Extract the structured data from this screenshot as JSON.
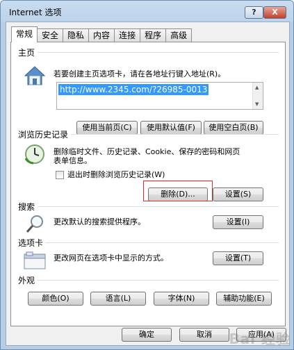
{
  "window": {
    "title": "Internet 选项",
    "help_label": "?",
    "close_label": "X"
  },
  "tabs": [
    {
      "label": "常规"
    },
    {
      "label": "安全"
    },
    {
      "label": "隐私"
    },
    {
      "label": "内容"
    },
    {
      "label": "连接"
    },
    {
      "label": "程序"
    },
    {
      "label": "高级"
    }
  ],
  "homepage": {
    "label": "主页",
    "description": "若要创建主页选项卡，请在各地址行键入地址(R)。",
    "url": "http://www.2345.com/?26985-0013",
    "use_current": "使用当前页(C)",
    "use_default": "使用默认值(F)",
    "use_blank": "使用空白页(B)"
  },
  "history": {
    "label": "浏览历史记录",
    "description_line1": "删除临时文件、历史记录、Cookie、保存的密码和网页",
    "description_line2": "表单信息。",
    "checkbox_label": "退出时删除浏览历史记录(W)",
    "delete_button": "删除(D)...",
    "settings_button": "设置(S)"
  },
  "search": {
    "label": "搜索",
    "description": "更改默认的搜索提供程序。",
    "settings_button": "设置(I)"
  },
  "tabs_section": {
    "label": "选项卡",
    "description": "更改网页在选项卡中显示的方式。",
    "settings_button": "设置(T)"
  },
  "appearance": {
    "label": "外观",
    "colors": "颜色(O)",
    "languages": "语言(L)",
    "fonts": "字体(N)",
    "accessibility": "辅助功能(E)"
  },
  "footer": {
    "ok": "确定",
    "cancel": "取消",
    "apply": "应用(A)"
  },
  "watermark": "Bai 经验"
}
